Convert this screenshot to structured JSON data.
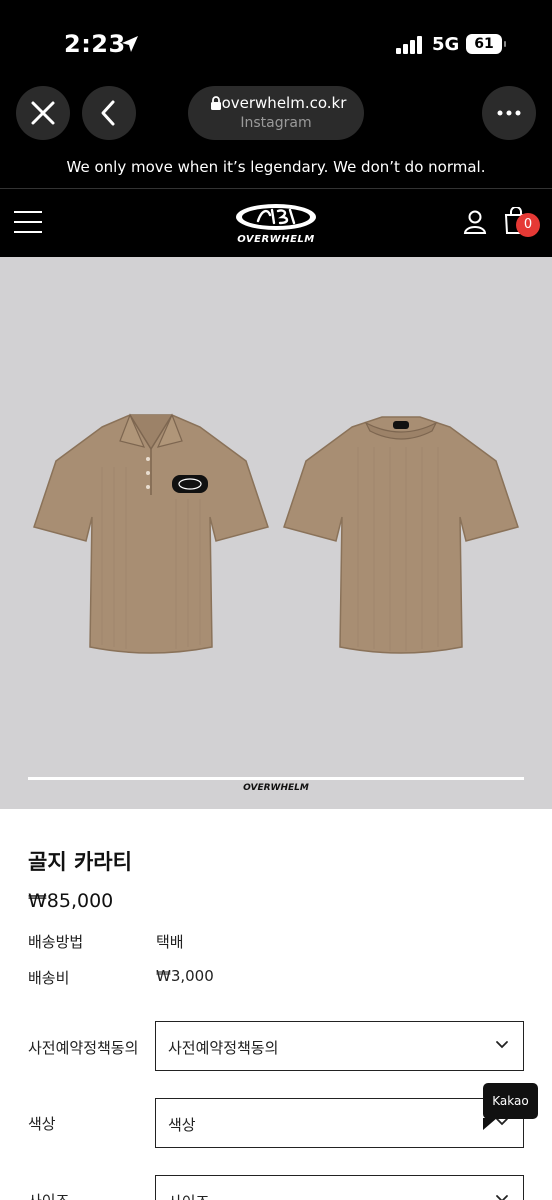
{
  "status_bar": {
    "time": "2:23",
    "network": "5G",
    "battery": "61"
  },
  "browser": {
    "url": "overwhelm.co.kr",
    "subtitle": "Instagram"
  },
  "banner": {
    "tagline": "We only move when it’s legendary. We don’t do normal."
  },
  "site_header": {
    "logo_text": "OVERWHELM",
    "cart_count": "0"
  },
  "hero": {
    "watermark": "OVERWHELM",
    "shirt_color": "#a88e73"
  },
  "product": {
    "name": "골지 카라티",
    "price": "₩85,000",
    "info": [
      {
        "label": "배송방법",
        "value": "택배"
      },
      {
        "label": "배송비",
        "value": "₩3,000"
      }
    ],
    "options": [
      {
        "label": "사전예약정책동의",
        "value": "사전예약정책동의"
      },
      {
        "label": "색상",
        "value": "색상"
      },
      {
        "label": "사이즈",
        "value": "사이즈"
      }
    ]
  },
  "chat": {
    "label": "Kakao"
  },
  "colors": {
    "chrome_bg": "#000000",
    "pill_bg": "#2b2b2b",
    "hero_bg": "#d2d1d3",
    "badge_red": "#e53935"
  }
}
